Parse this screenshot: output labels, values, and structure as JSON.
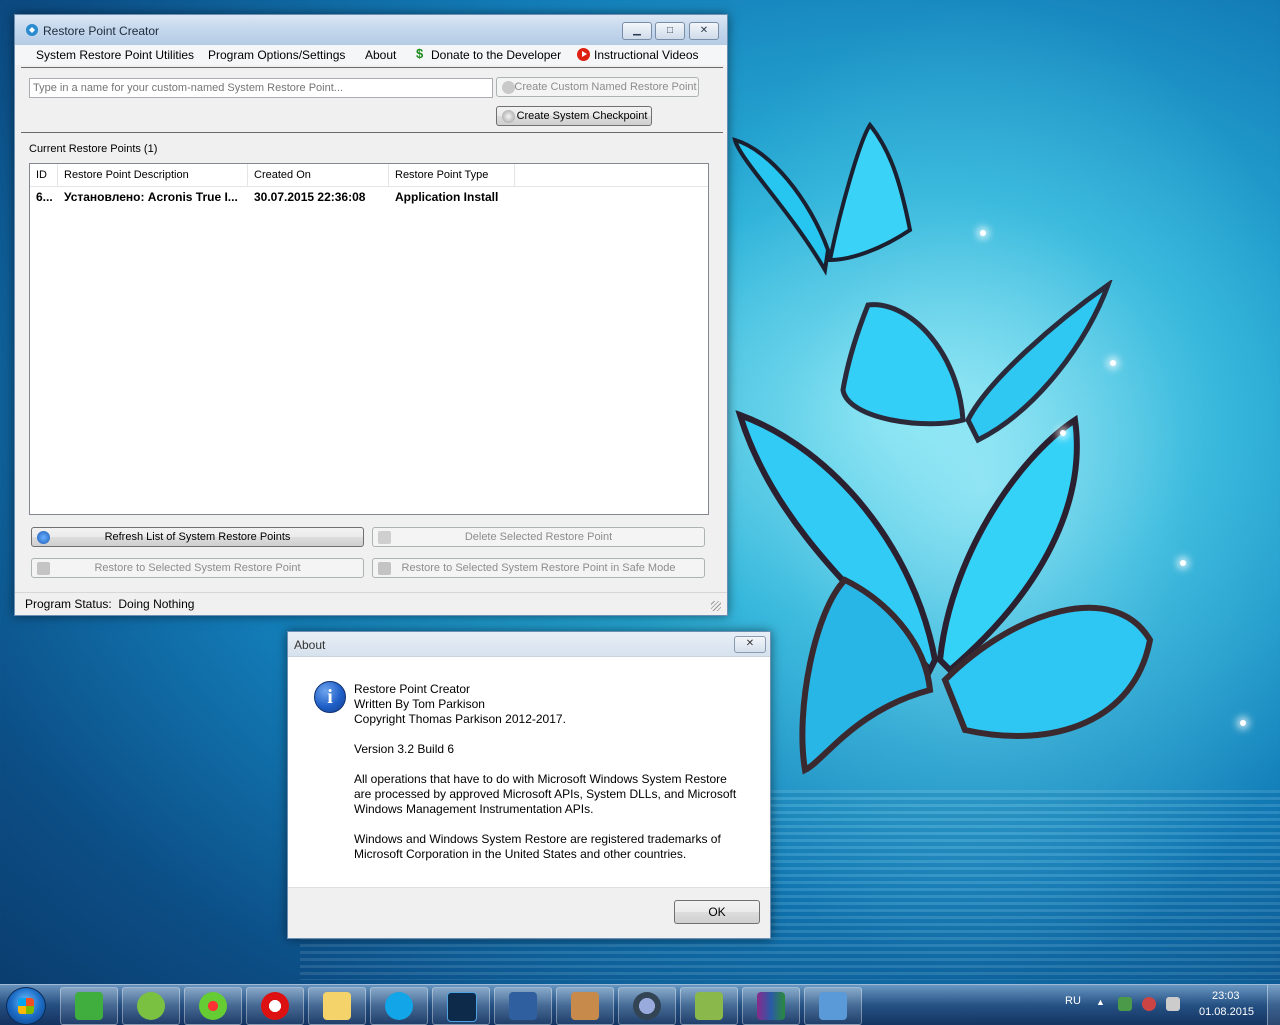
{
  "main_window": {
    "title": "Restore Point Creator",
    "minimize": "▁",
    "maximize": "□",
    "close": "✕",
    "menu": {
      "utilities": "System Restore Point Utilities",
      "options": "Program Options/Settings",
      "about": "About",
      "donate": "Donate to the Developer",
      "videos": "Instructional Videos"
    },
    "name_input_placeholder": "Type in a name for your custom-named System Restore Point...",
    "create_custom_label": "Create Custom Named Restore Point",
    "create_checkpoint_label": "Create System Checkpoint",
    "current_points_label": "Current Restore Points (1)",
    "columns": {
      "id": "ID",
      "description": "Restore Point Description",
      "created": "Created On",
      "type": "Restore Point Type"
    },
    "rows": [
      {
        "id": "6...",
        "description": "Установлено: Acronis True I...",
        "created": "30.07.2015 22:36:08",
        "type": "Application Install"
      }
    ],
    "refresh_label": "Refresh List of System Restore Points",
    "delete_label": "Delete Selected Restore Point",
    "restore_label": "Restore to Selected System Restore Point",
    "restore_safe_label": "Restore to Selected System Restore Point in Safe Mode",
    "status_label": "Program Status:",
    "status_value": "Doing Nothing"
  },
  "about_dialog": {
    "title": "About",
    "close": "✕",
    "info_icon_glyph": "i",
    "lines": {
      "app_name": "Restore Point Creator",
      "author": "Written By Tom Parkison",
      "copyright": "Copyright Thomas Parkison 2012-2017.",
      "version": "Version 3.2 Build 6",
      "ops1": "All operations that have to do with Microsoft Windows System Restore",
      "ops2": "are processed by approved Microsoft APIs, System DLLs, and Microsoft",
      "ops3": "Windows Management Instrumentation APIs.",
      "tm1": "Windows and Windows System Restore are registered trademarks of",
      "tm2": "Microsoft Corporation in the United States and other countries."
    },
    "ok_label": "OK"
  },
  "taskbar": {
    "items": [
      "mydefrag-icon",
      "utorrent-icon",
      "icq-icon",
      "opera-icon",
      "explorer-icon",
      "skype-icon",
      "photoshop-icon",
      "virtualbox-icon",
      "restore-icon",
      "search-icon",
      "tools-icon",
      "winrar-icon",
      "restore-point-creator-icon"
    ],
    "language": "RU",
    "time": "23:03",
    "date": "01.08.2015"
  }
}
